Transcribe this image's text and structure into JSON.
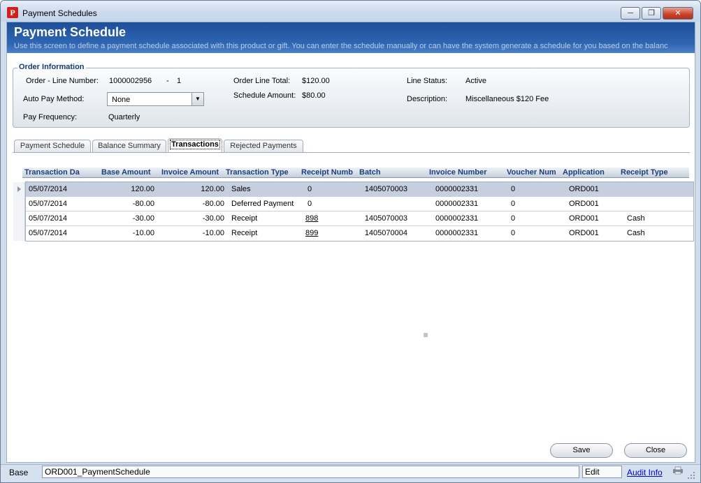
{
  "window": {
    "title": "Payment Schedules"
  },
  "banner": {
    "title": "Payment Schedule",
    "subtitle": "Use this screen to define a payment schedule associated with this product or gift. You can enter the schedule manually or can have the system generate a schedule for you based on the balanc"
  },
  "order_info": {
    "legend": "Order Information",
    "order_line_label": "Order - Line Number:",
    "order_number": "1000002956",
    "dash": "-",
    "line_number": "1",
    "auto_pay_label": "Auto Pay Method:",
    "auto_pay_value": "None",
    "pay_frequency_label": "Pay Frequency:",
    "pay_frequency_value": "Quarterly",
    "order_line_total_label": "Order Line Total:",
    "order_line_total_value": "$120.00",
    "schedule_amount_label": "Schedule Amount:",
    "schedule_amount_value": "$80.00",
    "line_status_label": "Line Status:",
    "line_status_value": "Active",
    "description_label": "Description:",
    "description_value": "Miscellaneous $120 Fee"
  },
  "tabs": [
    "Payment Schedule",
    "Balance Summary",
    "Transactions",
    "Rejected Payments"
  ],
  "grid": {
    "headers": [
      "Transaction Da",
      "Base Amount",
      "Invoice Amount",
      "Transaction Type",
      "Receipt Numb",
      "Batch",
      "Invoice Number",
      "Voucher Num",
      "Application",
      "Receipt Type"
    ],
    "rows": [
      {
        "date": "05/07/2014",
        "base": "120.00",
        "invoice_amt": "120.00",
        "type": "Sales",
        "receipt": "0",
        "batch": "1405070003",
        "invoice_no": "0000002331",
        "voucher": "0",
        "app": "ORD001",
        "receipt_type": ""
      },
      {
        "date": "05/07/2014",
        "base": "-80.00",
        "invoice_amt": "-80.00",
        "type": "Deferred Payment",
        "receipt": "0",
        "batch": "",
        "invoice_no": "0000002331",
        "voucher": "0",
        "app": "ORD001",
        "receipt_type": ""
      },
      {
        "date": "05/07/2014",
        "base": "-30.00",
        "invoice_amt": "-30.00",
        "type": "Receipt",
        "receipt": "898",
        "batch": "1405070003",
        "invoice_no": "0000002331",
        "voucher": "0",
        "app": "ORD001",
        "receipt_type": "Cash"
      },
      {
        "date": "05/07/2014",
        "base": "-10.00",
        "invoice_amt": "-10.00",
        "type": "Receipt",
        "receipt": "899",
        "batch": "1405070004",
        "invoice_no": "0000002331",
        "voucher": "0",
        "app": "ORD001",
        "receipt_type": "Cash"
      }
    ]
  },
  "buttons": {
    "save": "Save",
    "close": "Close"
  },
  "status": {
    "base": "Base",
    "form_name": "ORD001_PaymentSchedule",
    "mode": "Edit",
    "audit_info": "Audit Info"
  },
  "colors": {
    "banner": "#2f66b2",
    "header_text": "#1d3e78",
    "selected_row": "#c5cfdf",
    "link": "#0000cc"
  }
}
